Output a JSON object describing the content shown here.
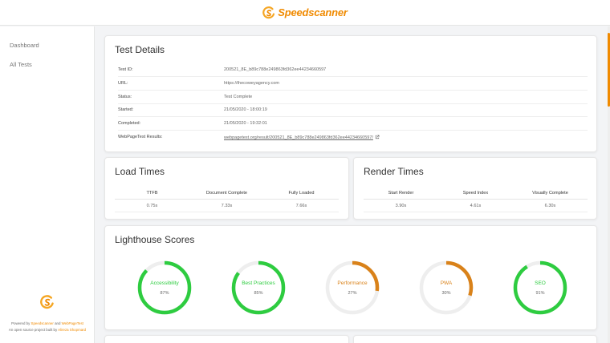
{
  "brand": {
    "name": "Speedscanner",
    "accent": "#f08a00"
  },
  "nav": {
    "items": [
      {
        "label": "Dashboard"
      },
      {
        "label": "All Tests"
      }
    ]
  },
  "footer": {
    "powered_prefix": "Powered by ",
    "powered_link1": "Speedscanner",
    "powered_and": " and ",
    "powered_link2": "WebPageTest",
    "open_source_prefix": "An open source project built by ",
    "author": "Alireza Shopmard"
  },
  "test_details": {
    "title": "Test Details",
    "rows": [
      {
        "key": "Test ID:",
        "value": "200521_8E_b89c788e249863fd362ee44234660597"
      },
      {
        "key": "URL:",
        "value": "https://thecoweyagency.com"
      },
      {
        "key": "Status:",
        "value": "Test Complete"
      },
      {
        "key": "Started:",
        "value": "21/05/2020 - 18:00:19"
      },
      {
        "key": "Completed:",
        "value": "21/05/2020 - 19:32:01"
      },
      {
        "key": "WebPageTest Results:",
        "value": "webpagetest.org/result/200521_8E_b89c788e249863fd362ee44234660597/",
        "icon": "external-link-icon"
      }
    ]
  },
  "load_times": {
    "title": "Load Times",
    "headers": [
      "TTFB",
      "Document Complete",
      "Fully Loaded"
    ],
    "values": [
      "0.75s",
      "7.33s",
      "7.66s"
    ]
  },
  "render_times": {
    "title": "Render Times",
    "headers": [
      "Start Render",
      "Speed Index",
      "Visually Complete"
    ],
    "values": [
      "3.90s",
      "4.61s",
      "6.30s"
    ]
  },
  "lighthouse": {
    "title": "Lighthouse Scores",
    "scores": [
      {
        "label": "Accessibility",
        "value": "87%",
        "fraction": 0.87,
        "color": "#2ecc40"
      },
      {
        "label": "Best Practices",
        "value": "85%",
        "fraction": 0.85,
        "color": "#2ecc40"
      },
      {
        "label": "Performance",
        "value": "27%",
        "fraction": 0.27,
        "color": "#d9821a"
      },
      {
        "label": "PWA",
        "value": "30%",
        "fraction": 0.3,
        "color": "#d9821a"
      },
      {
        "label": "SEO",
        "value": "91%",
        "fraction": 0.91,
        "color": "#2ecc40"
      }
    ]
  }
}
